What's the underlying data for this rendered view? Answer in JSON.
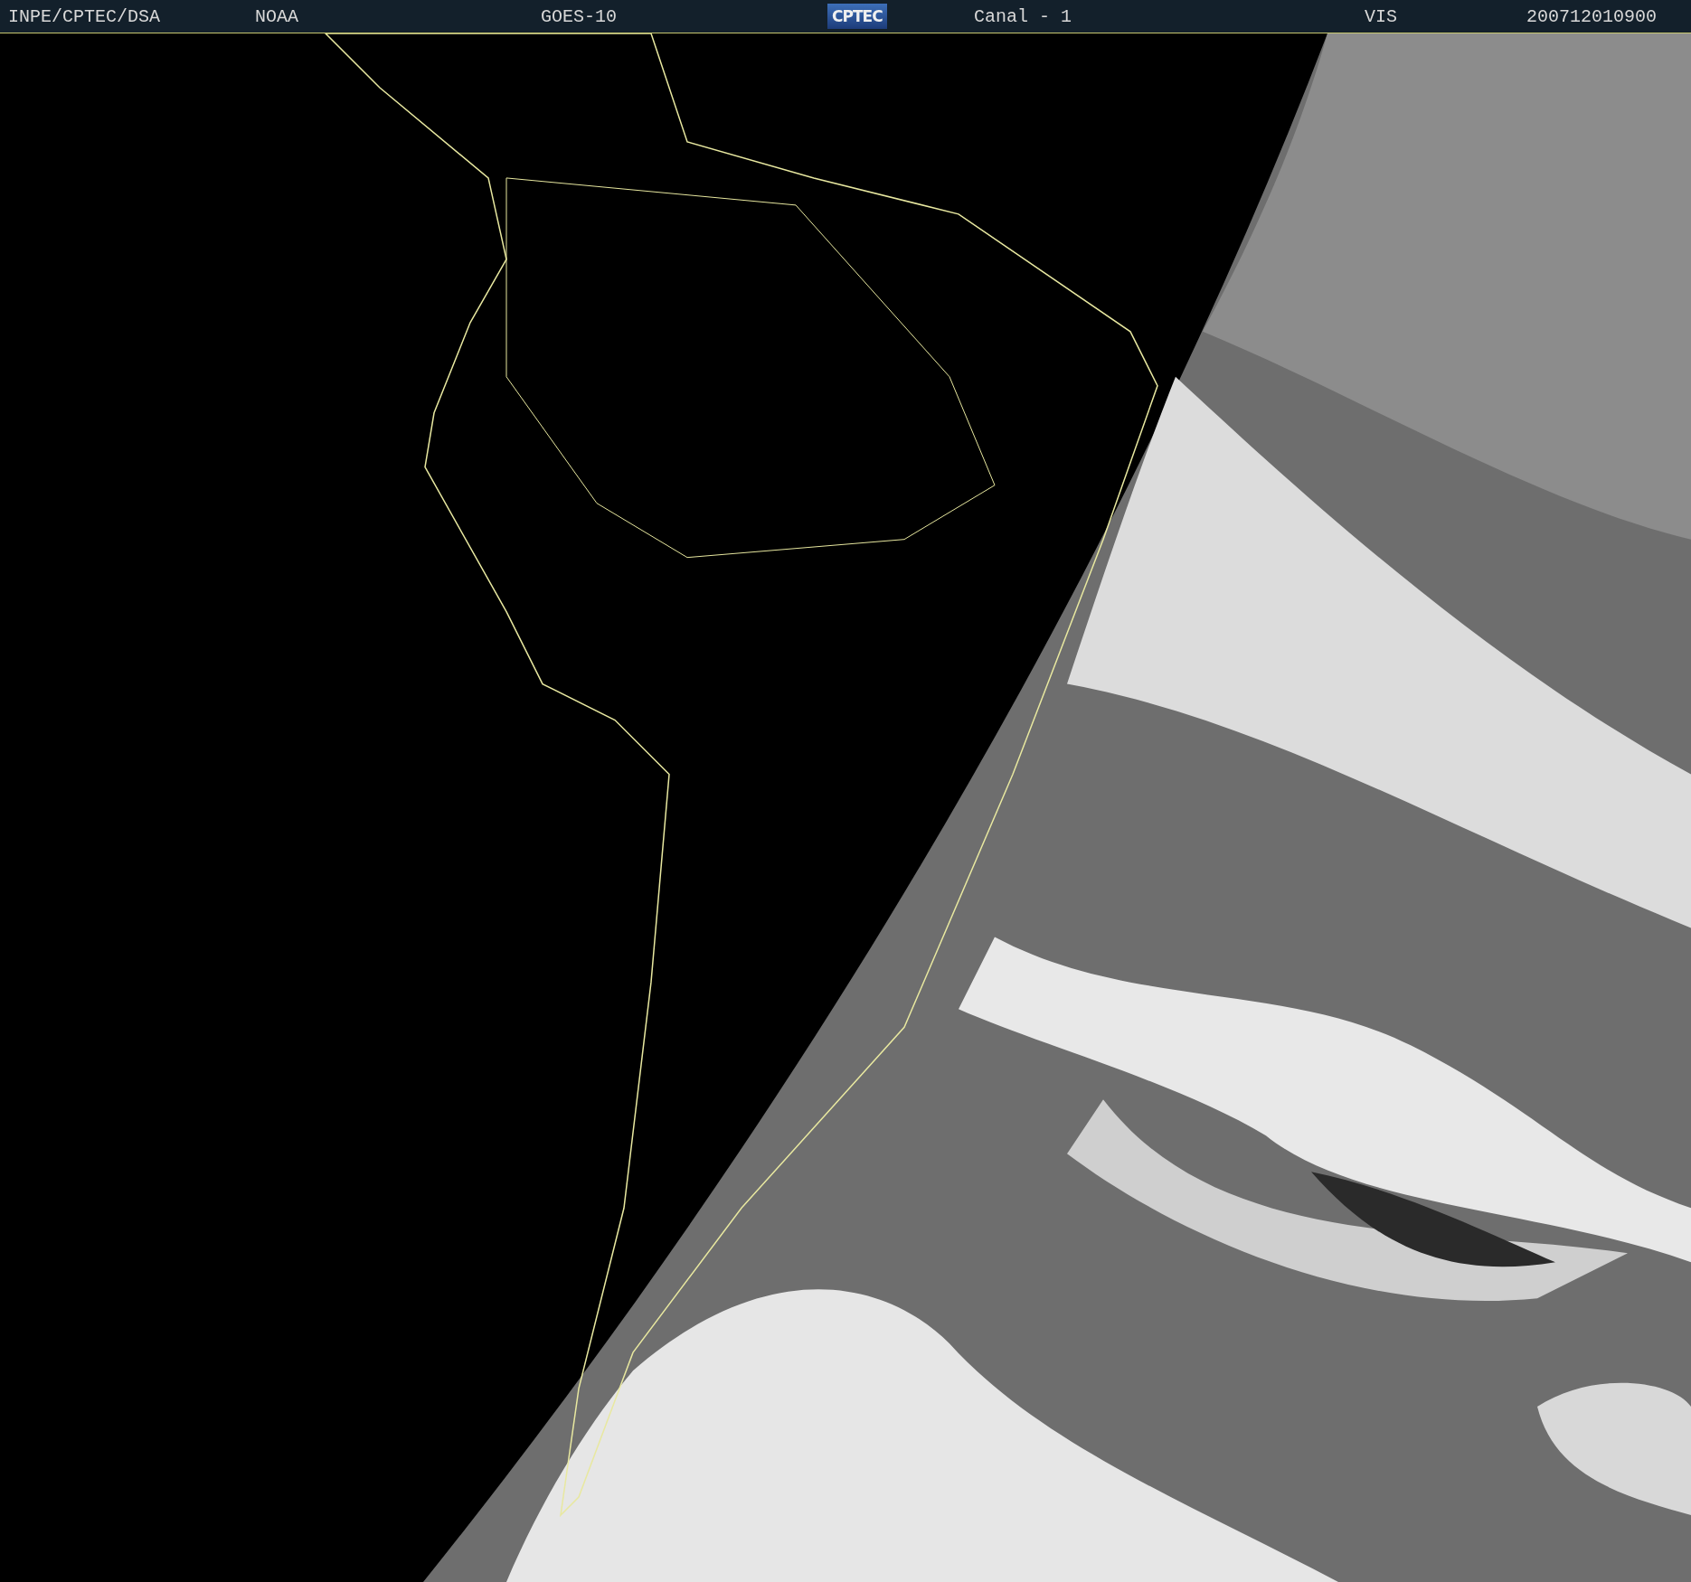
{
  "header": {
    "items": [
      {
        "kind": "text",
        "text": "INPE/CPTEC/DSA"
      },
      {
        "kind": "text",
        "text": "NOAA"
      },
      {
        "kind": "text",
        "text": "GOES-10"
      },
      {
        "kind": "logo",
        "text": "CPTEC"
      },
      {
        "kind": "text",
        "text": "Canal - 1"
      },
      {
        "kind": "text",
        "text": "VIS"
      },
      {
        "kind": "text",
        "text": "200712010900"
      }
    ]
  }
}
